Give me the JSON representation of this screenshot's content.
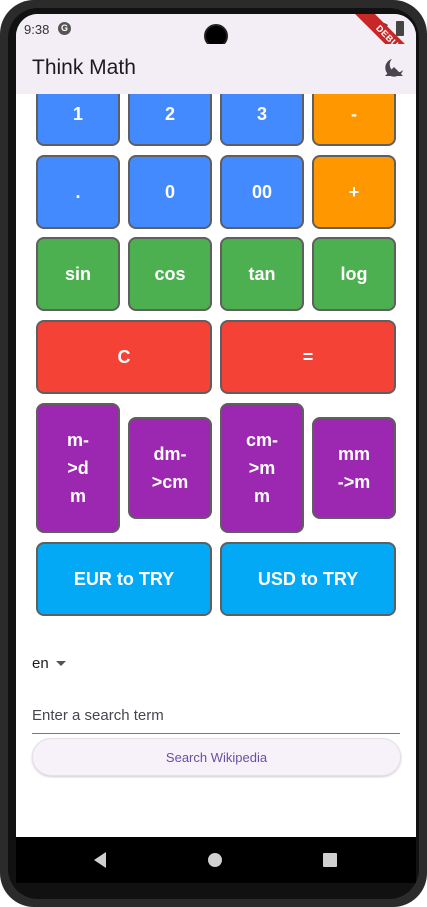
{
  "status_bar": {
    "time": "9:38",
    "notification_icon": "G",
    "debug_label": "DEBUG"
  },
  "app_bar": {
    "title": "Think Math",
    "theme_icon": "theme-toggle-icon"
  },
  "calculator": {
    "row1": [
      "1",
      "2",
      "3",
      "-"
    ],
    "row2": [
      ".",
      "0",
      "00",
      "+"
    ],
    "row3": [
      "sin",
      "cos",
      "tan",
      "log"
    ],
    "row4": [
      "C",
      "="
    ],
    "row5": [
      "m-\n>d\nm",
      "dm-\n>cm",
      "cm-\n>m\nm",
      "mm\n->m"
    ],
    "row6": [
      "EUR to TRY",
      "USD to TRY"
    ]
  },
  "language": {
    "selected": "en"
  },
  "search": {
    "placeholder": "Enter a search term",
    "value": "",
    "button_label": "Search Wikipedia"
  },
  "colors": {
    "number": "#448aff",
    "operator": "#ff9800",
    "function": "#4caf50",
    "clear_equals": "#f44336",
    "unit_conversion": "#9c27b0",
    "currency": "#03a9f4",
    "app_bar": "#f3edf6"
  }
}
